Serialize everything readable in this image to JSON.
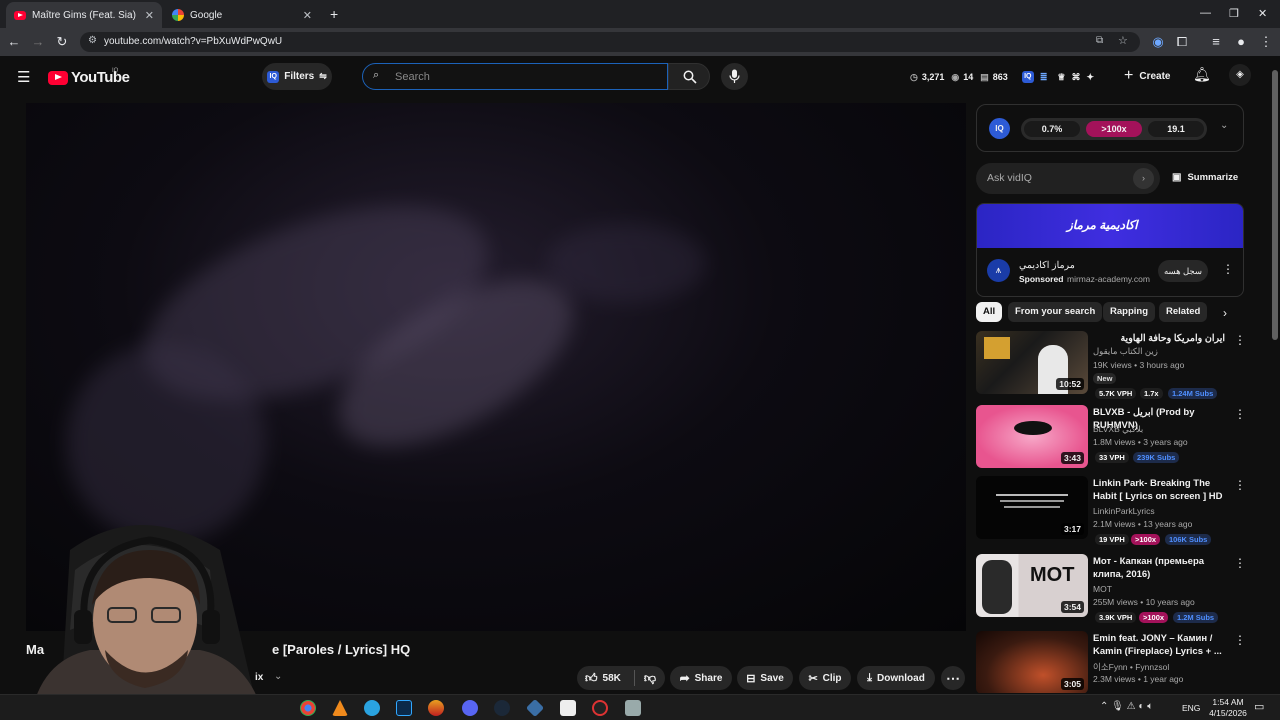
{
  "browser": {
    "tabs": [
      {
        "title": "Maître Gims (Feat. Sia) - Je Te P",
        "active": true
      },
      {
        "title": "Google",
        "active": false
      }
    ],
    "new_tab": "+",
    "url": "youtube.com/watch?v=PbXuWdPwQwU"
  },
  "header": {
    "logo_text": "YouTube",
    "logo_sup": "IQ",
    "filters_label": "Filters",
    "search_placeholder": "Search",
    "stats": {
      "time": "3,271",
      "eye": "14",
      "subs": "863"
    },
    "create_label": "Create"
  },
  "video": {
    "title_left": "Ma",
    "title_right": "e [Paroles / Lyrics] HQ",
    "mix_label": "ix",
    "actions": {
      "likes": "58K",
      "share": "Share",
      "save": "Save",
      "clip": "Clip",
      "download": "Download"
    }
  },
  "vidiq": {
    "logo": "IQ",
    "metrics": [
      "0.7%",
      ">100x",
      "19.1"
    ],
    "ask_placeholder": "Ask vidIQ",
    "summarize": "Summarize"
  },
  "ad": {
    "banner_text": "اكاديمية مرماز",
    "name": "مرماز اكاديمي",
    "sponsored": "Sponsored",
    "domain": "mirmaz-academy.com",
    "cta": "سجل هسه"
  },
  "chips": [
    "All",
    "From your search",
    "Rapping",
    "Related"
  ],
  "recommendations": [
    {
      "title": "ايران وامريكا وحافة الهاوية",
      "channel": "زين الكتاب مايقول",
      "meta": "19K views • 3 hours ago",
      "duration": "10:52",
      "badge": "New",
      "tags": [
        "5.7K VPH",
        "1.7x",
        "1.24M Subs"
      ]
    },
    {
      "title": "BLVXB - ابريل (Prod by RUHMVN)",
      "channel": "BLVXB بلاكبي",
      "meta": "1.8M views • 3 years ago",
      "duration": "3:43",
      "tags": [
        "33 VPH",
        "239K Subs"
      ]
    },
    {
      "title": "Linkin Park- Breaking The Habit [ Lyrics on screen ] HD",
      "channel": "LinkinParkLyrics",
      "meta": "2.1M views • 13 years ago",
      "duration": "3:17",
      "tags": [
        "19 VPH",
        ">100x",
        "106K Subs"
      ]
    },
    {
      "title": "Мот - Капкан (премьера клипа, 2016)",
      "channel": "MOT",
      "meta": "255M views • 10 years ago",
      "duration": "3:54",
      "tags": [
        "3.9K VPH",
        ">100x",
        "1.2M Subs"
      ]
    },
    {
      "title": "Emin feat. JONY – Камин / Kamin (Fireplace) Lyrics + ...",
      "channel": "이소Fynn • Fynnzsol",
      "meta": "2.3M views • 1 year ago",
      "duration": "3:05",
      "tags": []
    }
  ],
  "taskbar": {
    "lang": "ENG",
    "time": "1:54 AM",
    "date": "4/15/2026"
  }
}
